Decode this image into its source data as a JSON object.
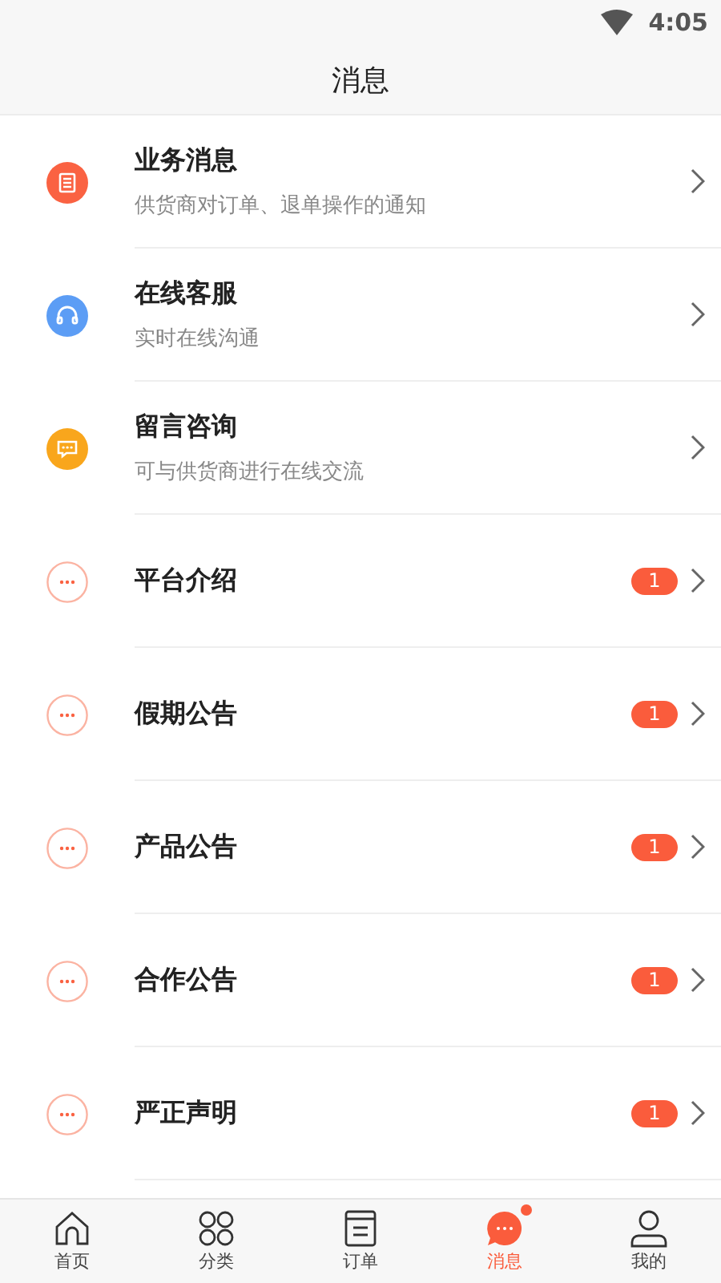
{
  "status_bar": {
    "time": "4:05"
  },
  "title": "消息",
  "items": [
    {
      "kind": "detail",
      "color": "#fa6242",
      "title": "业务消息",
      "subtitle": "供货商对订单、退单操作的通知"
    },
    {
      "kind": "detail",
      "color": "#5c9df5",
      "title": "在线客服",
      "subtitle": "实时在线沟通"
    },
    {
      "kind": "detail",
      "color": "#f9a61c",
      "title": "留言咨询",
      "subtitle": "可与供货商进行在线交流"
    },
    {
      "kind": "notice",
      "title": "平台介绍",
      "badge": "1"
    },
    {
      "kind": "notice",
      "title": "假期公告",
      "badge": "1"
    },
    {
      "kind": "notice",
      "title": "产品公告",
      "badge": "1"
    },
    {
      "kind": "notice",
      "title": "合作公告",
      "badge": "1"
    },
    {
      "kind": "notice",
      "title": "严正声明",
      "badge": "1"
    }
  ],
  "tabs": [
    {
      "label": "首页",
      "selected": false,
      "dot": false
    },
    {
      "label": "分类",
      "selected": false,
      "dot": false
    },
    {
      "label": "订单",
      "selected": false,
      "dot": false
    },
    {
      "label": "消息",
      "selected": true,
      "dot": true
    },
    {
      "label": "我的",
      "selected": false,
      "dot": false
    }
  ]
}
